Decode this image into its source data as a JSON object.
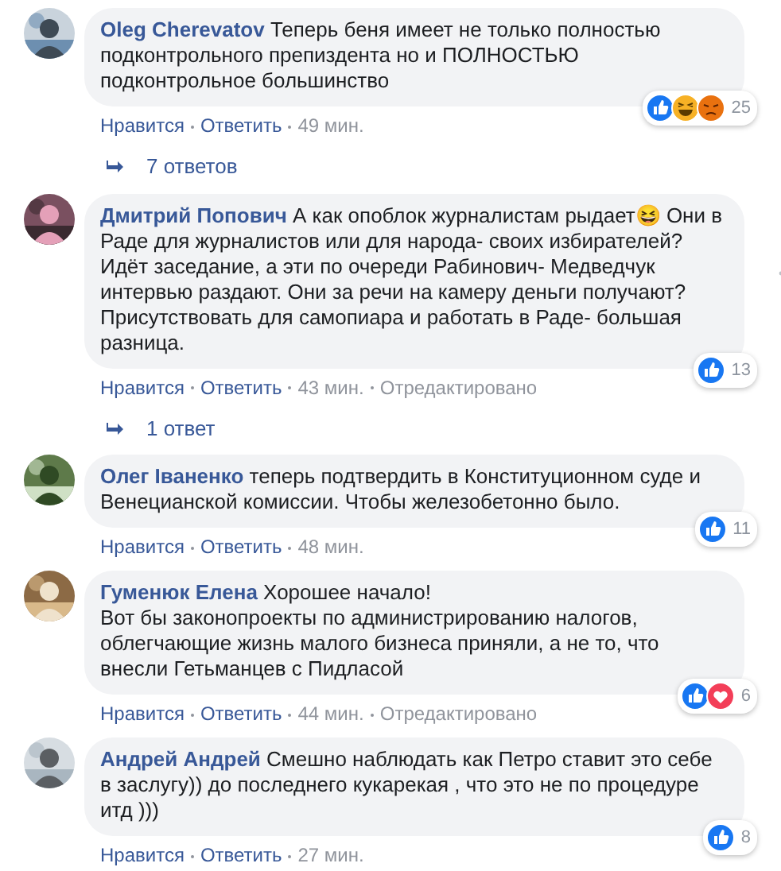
{
  "comments": [
    {
      "author": "Oleg Cherevatov",
      "text": "Теперь беня имеет не только полностью подконтрольного препиздента но и ПОЛНОСТЬЮ подконтрольное большинство",
      "reactions": [
        {
          "kind": "like"
        },
        {
          "kind": "haha"
        },
        {
          "kind": "angry"
        }
      ],
      "reaction_count": "25",
      "actions": [
        "Нравится",
        "Ответить"
      ],
      "time": "49 мин.",
      "replies": "7 ответов"
    },
    {
      "author": "Дмитрий Попович",
      "text": "А как опоблок журналистам рыдает😆 Они в Раде для журналистов или для народа- своих избирателей? Идёт заседание, а эти по очереди Рабинович- Медведчук интервью раздают. Они за речи на камеру деньги получают? Присутствовать для самопиара и работать в Раде- большая разница.",
      "reactions": [
        {
          "kind": "like"
        }
      ],
      "reaction_count": "13",
      "actions": [
        "Нравится",
        "Ответить"
      ],
      "time": "43 мин.",
      "edited": "Отредактировано",
      "replies": "1 ответ",
      "more_menu": true
    },
    {
      "author": "Олег Іваненко",
      "text": "теперь подтвердить в Конституционном суде и Венецианской комиссии. Чтобы железобетонно было.",
      "reactions": [
        {
          "kind": "like"
        }
      ],
      "reaction_count": "11",
      "actions": [
        "Нравится",
        "Ответить"
      ],
      "time": "48 мин."
    },
    {
      "author": "Гуменюк Елена",
      "text": "Хорошее начало!\nВот бы законопроекты по администрированию налогов, облегчающие жизнь малого бизнеса приняли, а не то, что внесли Гетьманцев с Пидласой",
      "reactions": [
        {
          "kind": "like"
        },
        {
          "kind": "love"
        }
      ],
      "reaction_count": "6",
      "actions": [
        "Нравится",
        "Ответить"
      ],
      "time": "44 мин.",
      "edited": "Отредактировано"
    },
    {
      "author": "Андрей Андрей",
      "text": "Смешно наблюдать как Петро ставит это себе в заслугу)) до последнего кукарекая , что это не по процедуре итд )))",
      "reactions": [
        {
          "kind": "like"
        }
      ],
      "reaction_count": "8",
      "actions": [
        "Нравится",
        "Ответить"
      ],
      "time": "27 мин."
    }
  ]
}
